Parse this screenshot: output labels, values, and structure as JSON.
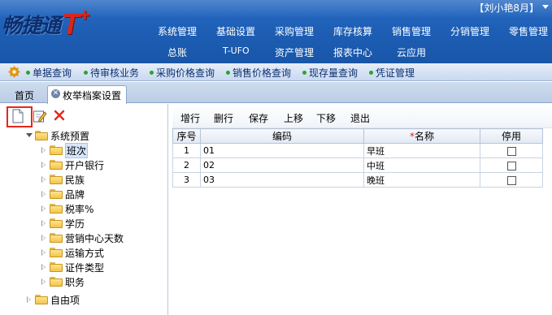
{
  "header": {
    "logo_text": "畅捷通",
    "logo_mark": "T",
    "logo_plus": "+",
    "user_label": "【刘小艳8月】",
    "menu_row1": [
      "系统管理",
      "基础设置",
      "采购管理",
      "库存核算",
      "销售管理",
      "分销管理",
      "零售管理"
    ],
    "menu_row2": [
      "总账",
      "T-UFO",
      "资产管理",
      "报表中心",
      "云应用"
    ]
  },
  "quickbar": {
    "items": [
      "单据查询",
      "待审核业务",
      "采购价格查询",
      "销售价格查询",
      "现存量查询",
      "凭证管理"
    ]
  },
  "tabs": {
    "home": "首页",
    "active": "枚举档案设置"
  },
  "tree": {
    "root": "系统预置",
    "children": [
      "班次",
      "开户银行",
      "民族",
      "品牌",
      "税率%",
      "学历",
      "营销中心天数",
      "运输方式",
      "证件类型",
      "职务"
    ],
    "selected": "班次",
    "other_root": "自由项"
  },
  "actions": [
    "增行",
    "删行",
    "保存",
    "上移",
    "下移",
    "退出"
  ],
  "table": {
    "headers": {
      "seq": "序号",
      "code": "编码",
      "name_marker": "*",
      "name": "名称",
      "disabled": "停用"
    },
    "rows": [
      {
        "seq": "1",
        "code": "01",
        "name": "早班",
        "disabled": false
      },
      {
        "seq": "2",
        "code": "02",
        "name": "中班",
        "disabled": false
      },
      {
        "seq": "3",
        "code": "03",
        "name": "晚班",
        "disabled": false
      }
    ]
  },
  "colors": {
    "header_blue": "#1e5fb6",
    "logo_red": "#d9261c",
    "highlight_red": "#e5271c",
    "quick_link": "#0b2f6e"
  }
}
